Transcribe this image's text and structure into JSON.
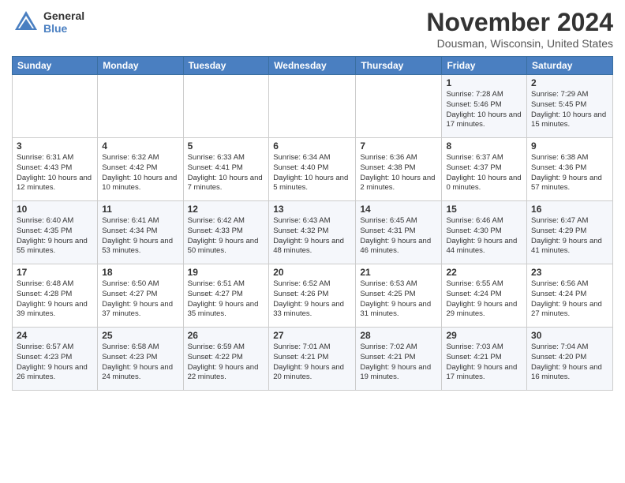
{
  "logo": {
    "general": "General",
    "blue": "Blue"
  },
  "title": "November 2024",
  "subtitle": "Dousman, Wisconsin, United States",
  "weekdays": [
    "Sunday",
    "Monday",
    "Tuesday",
    "Wednesday",
    "Thursday",
    "Friday",
    "Saturday"
  ],
  "weeks": [
    [
      {
        "day": "",
        "info": ""
      },
      {
        "day": "",
        "info": ""
      },
      {
        "day": "",
        "info": ""
      },
      {
        "day": "",
        "info": ""
      },
      {
        "day": "",
        "info": ""
      },
      {
        "day": "1",
        "info": "Sunrise: 7:28 AM\nSunset: 5:46 PM\nDaylight: 10 hours and 17 minutes."
      },
      {
        "day": "2",
        "info": "Sunrise: 7:29 AM\nSunset: 5:45 PM\nDaylight: 10 hours and 15 minutes."
      }
    ],
    [
      {
        "day": "3",
        "info": "Sunrise: 6:31 AM\nSunset: 4:43 PM\nDaylight: 10 hours and 12 minutes."
      },
      {
        "day": "4",
        "info": "Sunrise: 6:32 AM\nSunset: 4:42 PM\nDaylight: 10 hours and 10 minutes."
      },
      {
        "day": "5",
        "info": "Sunrise: 6:33 AM\nSunset: 4:41 PM\nDaylight: 10 hours and 7 minutes."
      },
      {
        "day": "6",
        "info": "Sunrise: 6:34 AM\nSunset: 4:40 PM\nDaylight: 10 hours and 5 minutes."
      },
      {
        "day": "7",
        "info": "Sunrise: 6:36 AM\nSunset: 4:38 PM\nDaylight: 10 hours and 2 minutes."
      },
      {
        "day": "8",
        "info": "Sunrise: 6:37 AM\nSunset: 4:37 PM\nDaylight: 10 hours and 0 minutes."
      },
      {
        "day": "9",
        "info": "Sunrise: 6:38 AM\nSunset: 4:36 PM\nDaylight: 9 hours and 57 minutes."
      }
    ],
    [
      {
        "day": "10",
        "info": "Sunrise: 6:40 AM\nSunset: 4:35 PM\nDaylight: 9 hours and 55 minutes."
      },
      {
        "day": "11",
        "info": "Sunrise: 6:41 AM\nSunset: 4:34 PM\nDaylight: 9 hours and 53 minutes."
      },
      {
        "day": "12",
        "info": "Sunrise: 6:42 AM\nSunset: 4:33 PM\nDaylight: 9 hours and 50 minutes."
      },
      {
        "day": "13",
        "info": "Sunrise: 6:43 AM\nSunset: 4:32 PM\nDaylight: 9 hours and 48 minutes."
      },
      {
        "day": "14",
        "info": "Sunrise: 6:45 AM\nSunset: 4:31 PM\nDaylight: 9 hours and 46 minutes."
      },
      {
        "day": "15",
        "info": "Sunrise: 6:46 AM\nSunset: 4:30 PM\nDaylight: 9 hours and 44 minutes."
      },
      {
        "day": "16",
        "info": "Sunrise: 6:47 AM\nSunset: 4:29 PM\nDaylight: 9 hours and 41 minutes."
      }
    ],
    [
      {
        "day": "17",
        "info": "Sunrise: 6:48 AM\nSunset: 4:28 PM\nDaylight: 9 hours and 39 minutes."
      },
      {
        "day": "18",
        "info": "Sunrise: 6:50 AM\nSunset: 4:27 PM\nDaylight: 9 hours and 37 minutes."
      },
      {
        "day": "19",
        "info": "Sunrise: 6:51 AM\nSunset: 4:27 PM\nDaylight: 9 hours and 35 minutes."
      },
      {
        "day": "20",
        "info": "Sunrise: 6:52 AM\nSunset: 4:26 PM\nDaylight: 9 hours and 33 minutes."
      },
      {
        "day": "21",
        "info": "Sunrise: 6:53 AM\nSunset: 4:25 PM\nDaylight: 9 hours and 31 minutes."
      },
      {
        "day": "22",
        "info": "Sunrise: 6:55 AM\nSunset: 4:24 PM\nDaylight: 9 hours and 29 minutes."
      },
      {
        "day": "23",
        "info": "Sunrise: 6:56 AM\nSunset: 4:24 PM\nDaylight: 9 hours and 27 minutes."
      }
    ],
    [
      {
        "day": "24",
        "info": "Sunrise: 6:57 AM\nSunset: 4:23 PM\nDaylight: 9 hours and 26 minutes."
      },
      {
        "day": "25",
        "info": "Sunrise: 6:58 AM\nSunset: 4:23 PM\nDaylight: 9 hours and 24 minutes."
      },
      {
        "day": "26",
        "info": "Sunrise: 6:59 AM\nSunset: 4:22 PM\nDaylight: 9 hours and 22 minutes."
      },
      {
        "day": "27",
        "info": "Sunrise: 7:01 AM\nSunset: 4:21 PM\nDaylight: 9 hours and 20 minutes."
      },
      {
        "day": "28",
        "info": "Sunrise: 7:02 AM\nSunset: 4:21 PM\nDaylight: 9 hours and 19 minutes."
      },
      {
        "day": "29",
        "info": "Sunrise: 7:03 AM\nSunset: 4:21 PM\nDaylight: 9 hours and 17 minutes."
      },
      {
        "day": "30",
        "info": "Sunrise: 7:04 AM\nSunset: 4:20 PM\nDaylight: 9 hours and 16 minutes."
      }
    ]
  ]
}
